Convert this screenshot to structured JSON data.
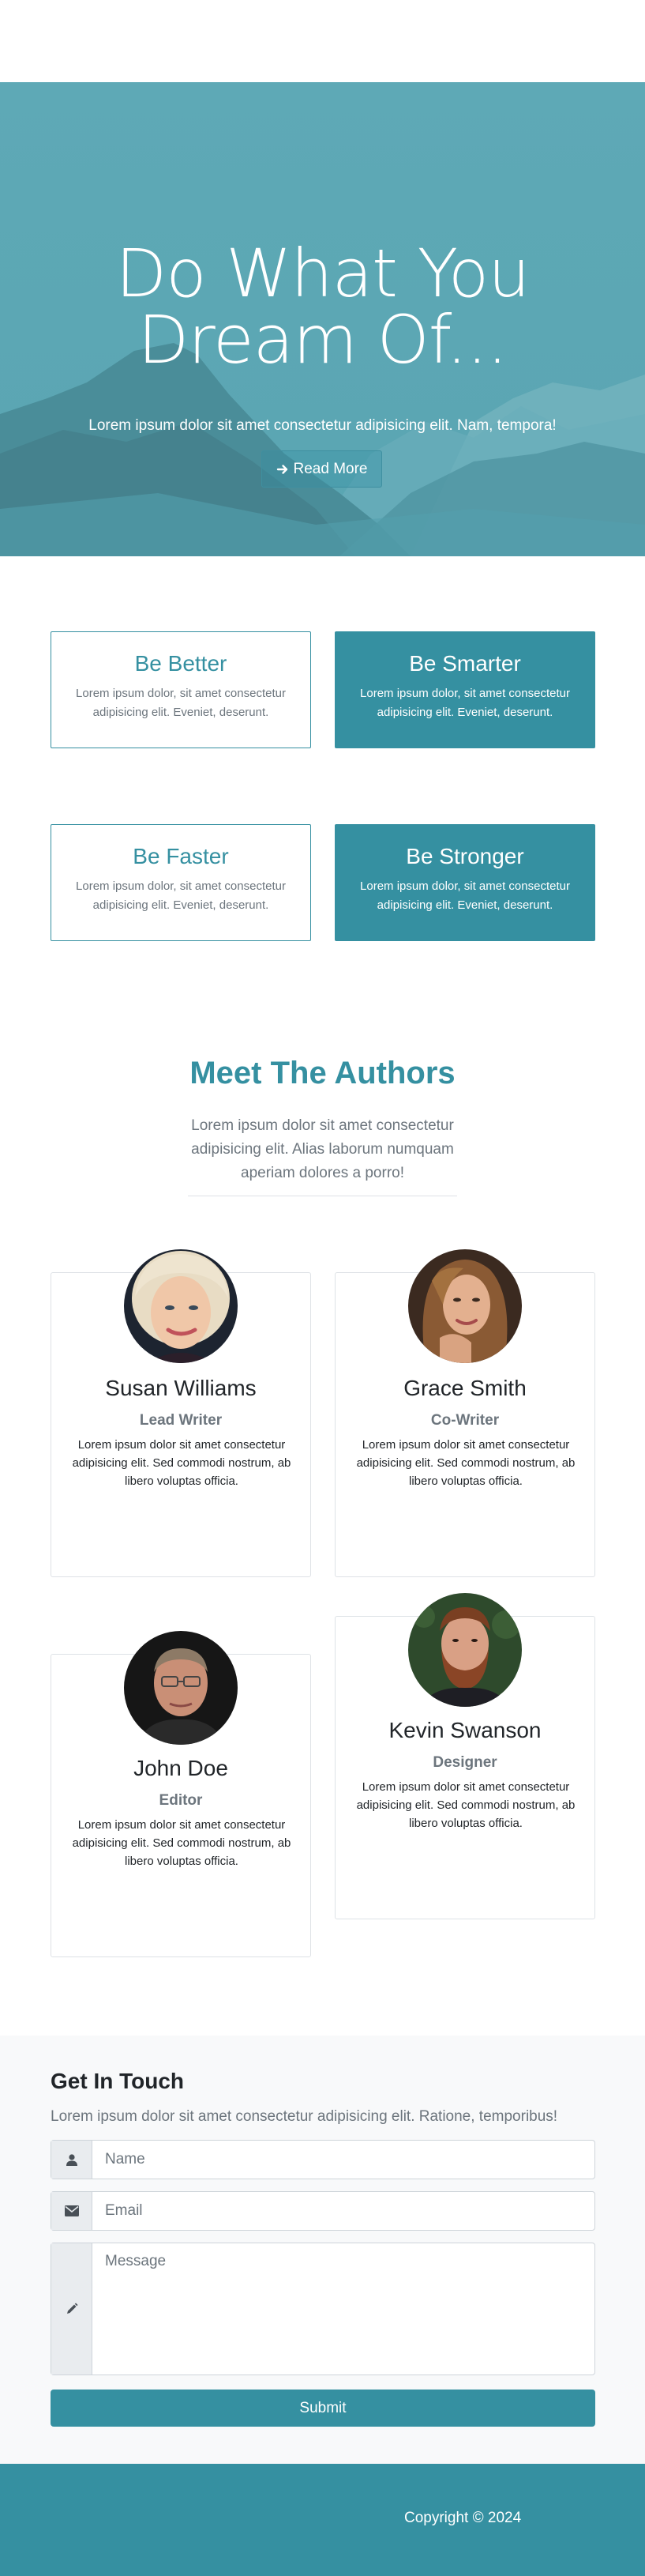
{
  "hero": {
    "title_line1": "Do What You",
    "title_line2": "Dream Of...",
    "subtitle": "Lorem ipsum dolor sit amet consectetur adipisicing elit. Nam, tempora!",
    "button_label": "Read More",
    "button_icon": "arrow-right-icon"
  },
  "features": [
    {
      "title": "Be Better",
      "text": "Lorem ipsum dolor, sit amet consectetur adipisicing elit. Eveniet, deserunt."
    },
    {
      "title": "Be Smarter",
      "text": "Lorem ipsum dolor, sit amet consectetur adipisicing elit. Eveniet, deserunt."
    },
    {
      "title": "Be Faster",
      "text": "Lorem ipsum dolor, sit amet consectetur adipisicing elit. Eveniet, deserunt."
    },
    {
      "title": "Be Stronger",
      "text": "Lorem ipsum dolor, sit amet consectetur adipisicing elit. Eveniet, deserunt."
    }
  ],
  "authors": {
    "title": "Meet The Authors",
    "subtitle": "Lorem ipsum dolor sit amet consectetur adipisicing elit. Alias laborum numquam aperiam dolores a porro!",
    "people": [
      {
        "name": "Susan Williams",
        "role": "Lead Writer",
        "bio": "Lorem ipsum dolor sit amet consectetur adipisicing elit. Sed commodi nostrum, ab libero voluptas officia."
      },
      {
        "name": "Grace Smith",
        "role": "Co-Writer",
        "bio": "Lorem ipsum dolor sit amet consectetur adipisicing elit. Sed commodi nostrum, ab libero voluptas officia."
      },
      {
        "name": "John Doe",
        "role": "Editor",
        "bio": "Lorem ipsum dolor sit amet consectetur adipisicing elit. Sed commodi nostrum, ab libero voluptas officia."
      },
      {
        "name": "Kevin Swanson",
        "role": "Designer",
        "bio": "Lorem ipsum dolor sit amet consectetur adipisicing elit. Sed commodi nostrum, ab libero voluptas officia."
      }
    ]
  },
  "contact": {
    "title": "Get In Touch",
    "subtitle": "Lorem ipsum dolor sit amet consectetur adipisicing elit. Ratione, temporibus!",
    "name_placeholder": "Name",
    "email_placeholder": "Email",
    "message_placeholder": "Message",
    "submit_label": "Submit"
  },
  "footer": {
    "copyright": "Copyright © 2024"
  },
  "colors": {
    "primary": "#3590a1",
    "hero_bg": "#5aa7b4"
  }
}
